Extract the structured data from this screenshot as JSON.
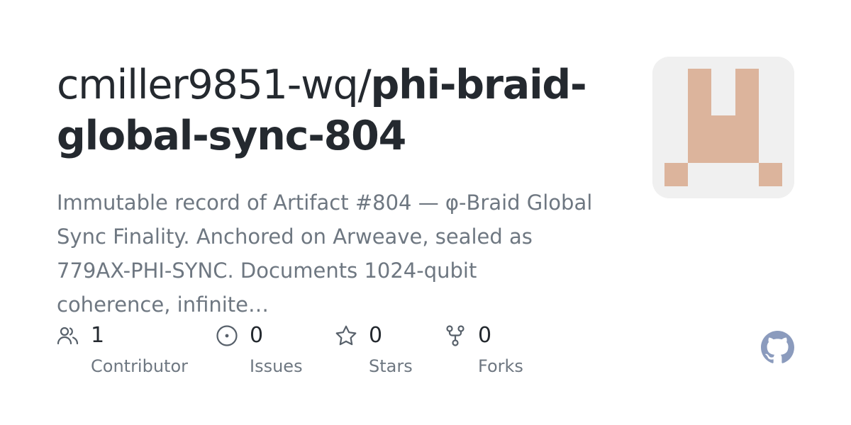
{
  "repo": {
    "owner_prefix": "cmiller9851-wq/",
    "name": "phi-braid-global-sync-804",
    "description": "Immutable record of Artifact #804 — φ-Braid Global Sync Finality. Anchored on Arweave, sealed as 779AX-PHI-SYNC. Documents 1024-qubit coherence, infinite…"
  },
  "stats": {
    "contributors": {
      "count": "1",
      "label": "Contributor",
      "icon": "people-icon"
    },
    "issues": {
      "count": "0",
      "label": "Issues",
      "icon": "issue-opened-icon"
    },
    "stars": {
      "count": "0",
      "label": "Stars",
      "icon": "star-icon"
    },
    "forks": {
      "count": "0",
      "label": "Forks",
      "icon": "repo-forked-icon"
    }
  },
  "avatar": {
    "background": "#f0f0f0",
    "fill": "#dcb49c"
  },
  "colors": {
    "title": "#24292f",
    "muted": "#6e7781",
    "icon": "#57606a",
    "github_mark": "#8b9bbd"
  }
}
